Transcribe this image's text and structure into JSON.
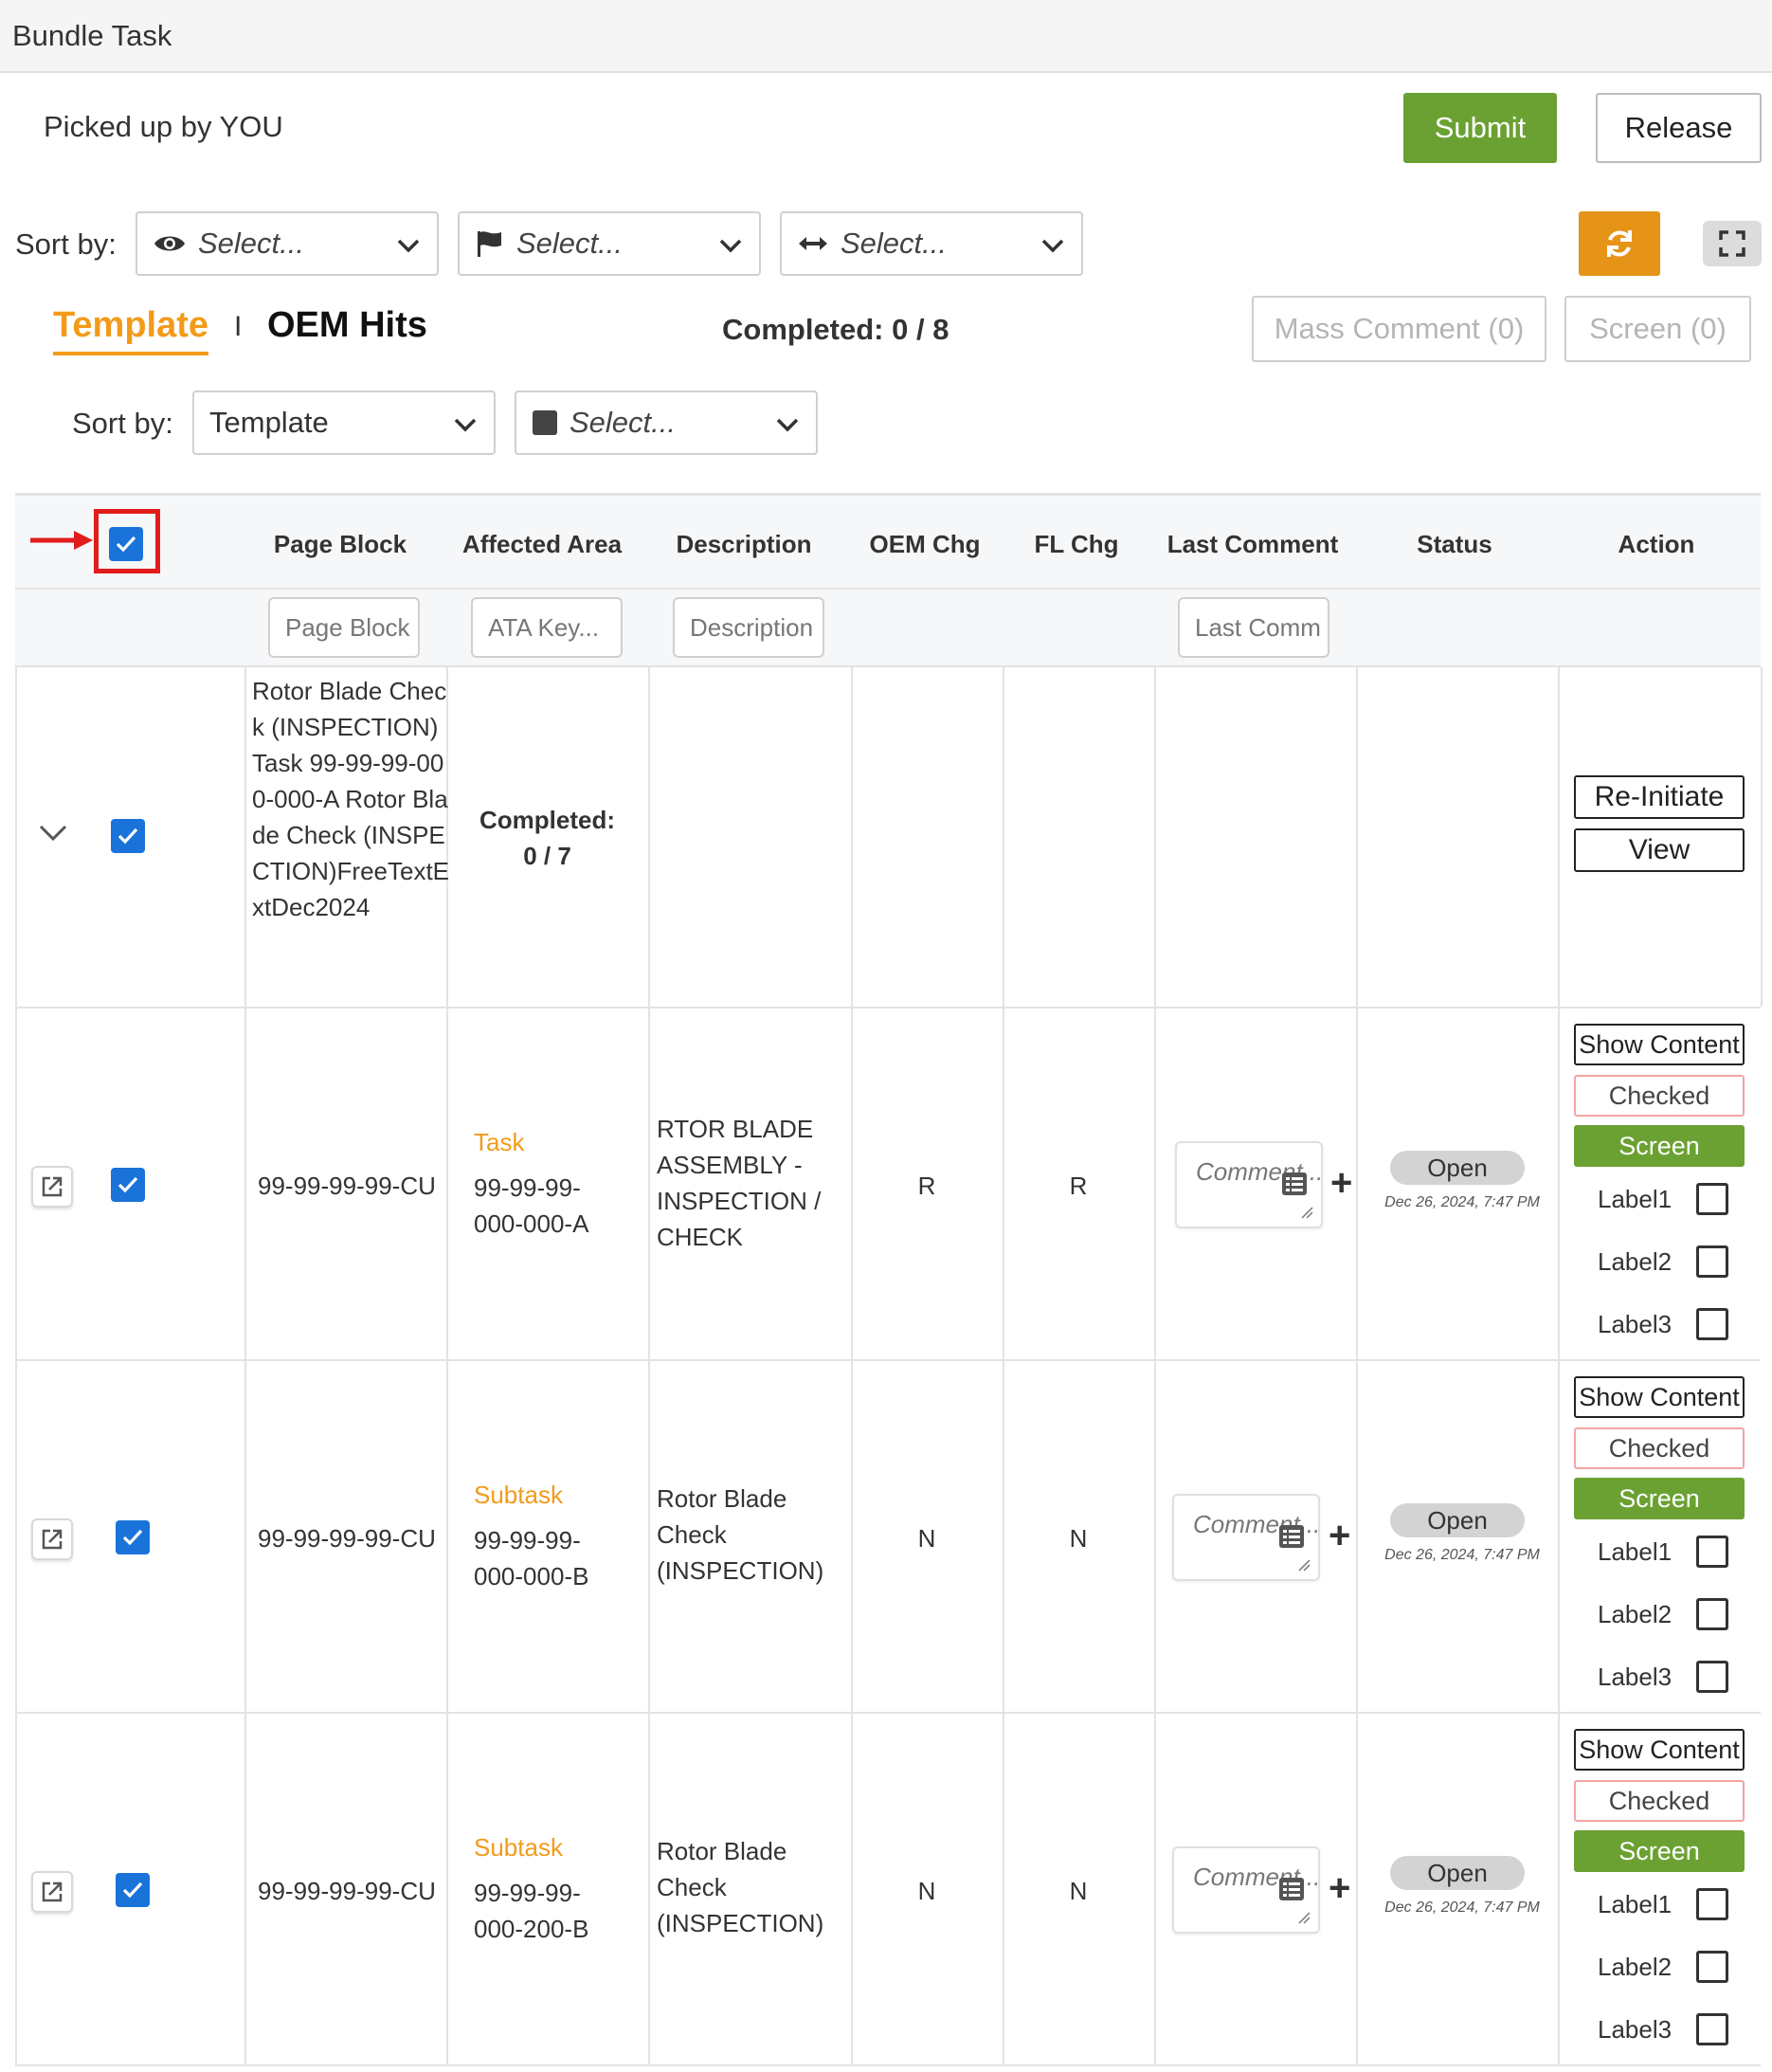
{
  "title": "Bundle Task",
  "picked_up": "Picked up by YOU",
  "buttons": {
    "submit": "Submit",
    "release": "Release"
  },
  "sort_by_label": "Sort by:",
  "top_sorts": [
    {
      "placeholder": "Select...",
      "icon": "eye-icon"
    },
    {
      "placeholder": "Select...",
      "icon": "flag-icon"
    },
    {
      "placeholder": "Select...",
      "icon": "arrows-horizontal-icon"
    }
  ],
  "tabs": {
    "active": "Template",
    "separator": "I",
    "other": "OEM Hits"
  },
  "completed_summary": "Completed: 0 / 8",
  "mass_comment": "Mass Comment (0)",
  "screen_btn": "Screen (0)",
  "secondary_sort": {
    "label": "Sort by:",
    "value": "Template",
    "second_placeholder": "Select..."
  },
  "columns": [
    "Page Block",
    "Affected Area",
    "Description",
    "OEM Chg",
    "FL Chg",
    "Last Comment",
    "Status",
    "Action"
  ],
  "filters": {
    "page_block": "Page Block",
    "ata_key": "ATA Key...",
    "description": "Description",
    "last_comment": "Last Comm"
  },
  "group_row": {
    "page_block": "Rotor Blade Check (INSPECTION) Task 99-99-99-000-000-A Rotor Blade Check (INSPECTION)FreeTextExtDec2024",
    "completed_label": "Completed:",
    "completed_value": "0 / 7",
    "actions": [
      "Re-Initiate",
      "View"
    ]
  },
  "rows": [
    {
      "page_block": "99-99-99-99-CU",
      "type": "Task",
      "area_code": "99-99-99-000-000-A",
      "description": "RTOR BLADE ASSEMBLY - INSPECTION / CHECK",
      "oem_chg": "R",
      "fl_chg": "R",
      "comment_placeholder": "Comment...",
      "status": "Open",
      "date": "Dec 26, 2024, 7:47 PM"
    },
    {
      "page_block": "99-99-99-99-CU",
      "type": "Subtask",
      "area_code": "99-99-99-000-000-B",
      "description": "Rotor Blade Check (INSPECTION)",
      "oem_chg": "N",
      "fl_chg": "N",
      "comment_placeholder": "Comment...",
      "status": "Open",
      "date": "Dec 26, 2024, 7:47 PM"
    },
    {
      "page_block": "99-99-99-99-CU",
      "type": "Subtask",
      "area_code": "99-99-99-000-200-B",
      "description": "Rotor Blade Check (INSPECTION)",
      "oem_chg": "N",
      "fl_chg": "N",
      "comment_placeholder": "Comment...",
      "status": "Open",
      "date": "Dec 26, 2024, 7:47 PM"
    }
  ],
  "row_actions": {
    "show_content": "Show Content",
    "checked": "Checked",
    "screen": "Screen",
    "labels": [
      "Label1",
      "Label2",
      "Label3"
    ]
  },
  "colors": {
    "green": "#6ba132",
    "orange": "#f29b1a",
    "checkbox_blue": "#1a73d9",
    "highlight_red": "#e21c1c"
  }
}
